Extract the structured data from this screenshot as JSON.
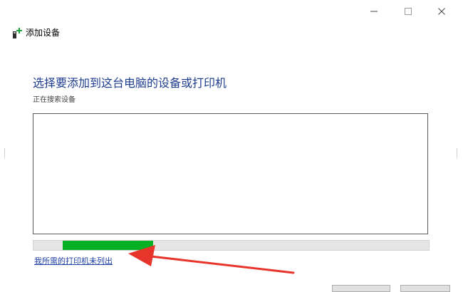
{
  "window": {
    "title": "添加设备",
    "controls": {
      "minimize": "minimize-icon",
      "maximize": "maximize-icon",
      "close": "close-icon"
    }
  },
  "main": {
    "heading": "选择要添加到这台电脑的设备或打印机",
    "status": "正在搜索设备",
    "device_list": [],
    "progress": {
      "start": 0.074,
      "end": 0.302,
      "color": "#06b025"
    },
    "missing_printer_link": "我所需的打印机未列出"
  },
  "annotation": {
    "arrow_color": "#e8352b"
  },
  "colors": {
    "heading": "#1f3d8f",
    "link": "#1e3fa6",
    "border": "#5a5a5a"
  }
}
